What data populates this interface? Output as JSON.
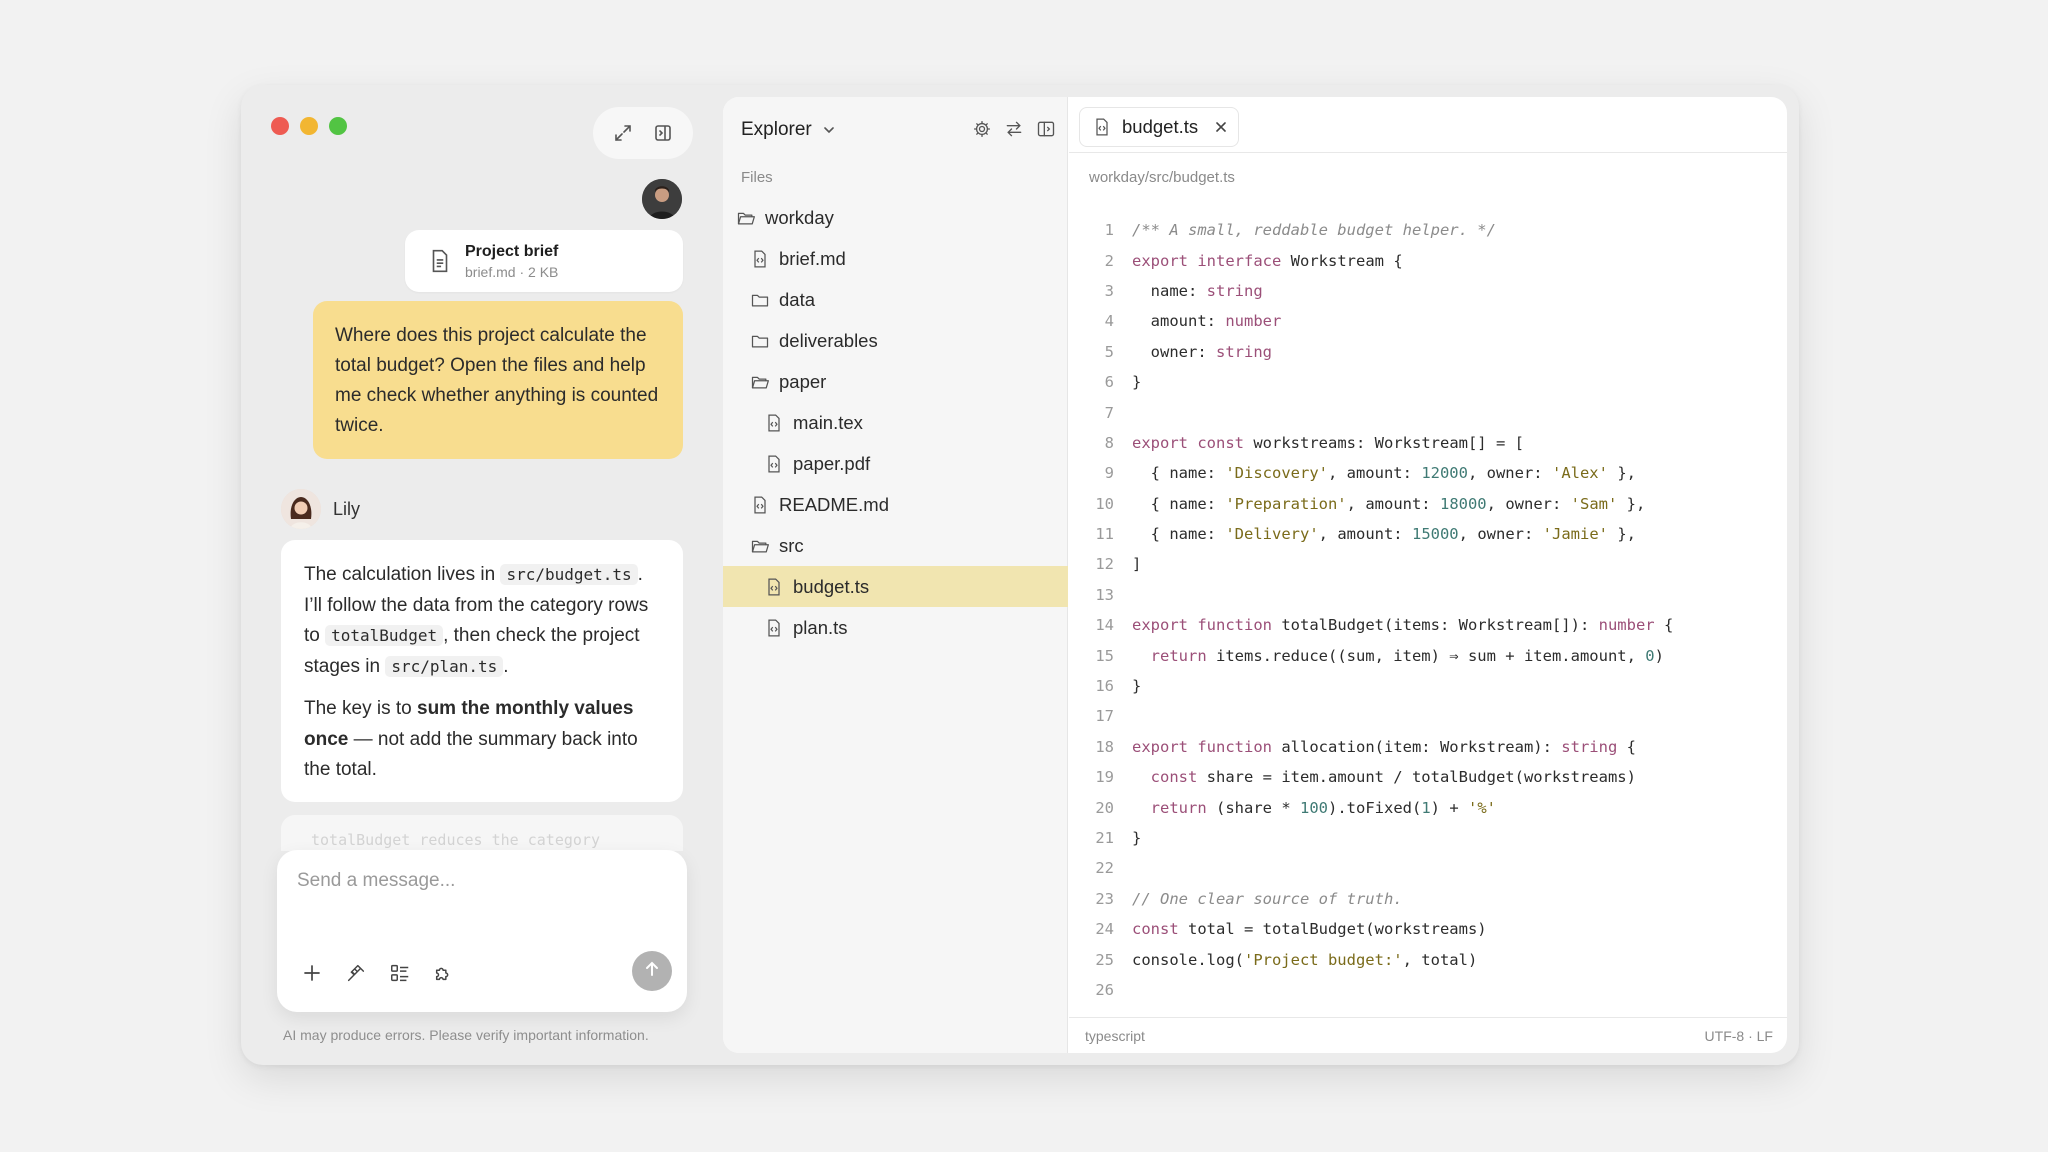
{
  "window": {
    "traffic_lights": [
      "close",
      "minimize",
      "maximize"
    ],
    "top_tools": [
      "expand-icon",
      "panel-toggle-icon"
    ]
  },
  "chat": {
    "attachment": {
      "title": "Project brief",
      "subtitle": "brief.md · 2 KB",
      "icon": "document-icon"
    },
    "user_message": "Where does this project calculate the total budget? Open the files and help me check whether anything is counted twice.",
    "assistant": {
      "name": "Lily",
      "p1": {
        "t1": "The calculation lives in ",
        "c1": "src/budget.ts",
        "t2": ". I’ll follow the data from the category rows to ",
        "c2": "totalBudget",
        "t3": ", then check the project stages in ",
        "c3": "src/plan.ts",
        "t4": "."
      },
      "p2": {
        "t1": "The key is to ",
        "b1": "sum the monthly values once",
        "t2": " — not add the summary back into the total."
      }
    },
    "faded_preview": "totalBudget reduces the category",
    "composer": {
      "placeholder": "Send a message...",
      "tools": [
        "plus-icon",
        "plug-icon",
        "list-icon",
        "puzzle-icon"
      ],
      "send_icon": "arrow-up-icon"
    },
    "disclaimer": "AI may produce errors. Please verify important information."
  },
  "explorer": {
    "title": "Explorer",
    "tools": [
      "gear-icon",
      "swap-icon",
      "split-panel-icon"
    ],
    "section_label": "Files",
    "tree": [
      {
        "label": "workday",
        "kind": "folder-open",
        "depth": 0
      },
      {
        "label": "brief.md",
        "kind": "file",
        "depth": 1
      },
      {
        "label": "data",
        "kind": "folder",
        "depth": 1
      },
      {
        "label": "deliverables",
        "kind": "folder",
        "depth": 1
      },
      {
        "label": "paper",
        "kind": "folder-open",
        "depth": 1
      },
      {
        "label": "main.tex",
        "kind": "file",
        "depth": 2
      },
      {
        "label": "paper.pdf",
        "kind": "file",
        "depth": 2
      },
      {
        "label": "README.md",
        "kind": "file",
        "depth": 1
      },
      {
        "label": "src",
        "kind": "folder-open",
        "depth": 1
      },
      {
        "label": "budget.ts",
        "kind": "file",
        "depth": 2,
        "selected": true
      },
      {
        "label": "plan.ts",
        "kind": "file",
        "depth": 2
      }
    ]
  },
  "editor": {
    "tab": {
      "label": "budget.ts"
    },
    "path": "workday/src/budget.ts",
    "lines": [
      [
        [
          "c",
          "/** A small, reddable budget helper. */"
        ]
      ],
      [
        [
          "k",
          "export"
        ],
        [
          "p",
          " "
        ],
        [
          "k",
          "interface"
        ],
        [
          "p",
          " Workstream {"
        ]
      ],
      [
        [
          "p",
          "  name: "
        ],
        [
          "t",
          "string"
        ]
      ],
      [
        [
          "p",
          "  amount: "
        ],
        [
          "t",
          "number"
        ]
      ],
      [
        [
          "p",
          "  owner: "
        ],
        [
          "t",
          "string"
        ]
      ],
      [
        [
          "p",
          "}"
        ]
      ],
      [],
      [
        [
          "k",
          "export"
        ],
        [
          "p",
          " "
        ],
        [
          "k",
          "const"
        ],
        [
          "p",
          " workstreams: Workstream[] = ["
        ]
      ],
      [
        [
          "p",
          "  { name: "
        ],
        [
          "s",
          "'Discovery'"
        ],
        [
          "p",
          ", amount: "
        ],
        [
          "n",
          "12000"
        ],
        [
          "p",
          ", owner: "
        ],
        [
          "s",
          "'Alex'"
        ],
        [
          "p",
          " },"
        ]
      ],
      [
        [
          "p",
          "  { name: "
        ],
        [
          "s",
          "'Preparation'"
        ],
        [
          "p",
          ", amount: "
        ],
        [
          "n",
          "18000"
        ],
        [
          "p",
          ", owner: "
        ],
        [
          "s",
          "'Sam'"
        ],
        [
          "p",
          " },"
        ]
      ],
      [
        [
          "p",
          "  { name: "
        ],
        [
          "s",
          "'Delivery'"
        ],
        [
          "p",
          ", amount: "
        ],
        [
          "n",
          "15000"
        ],
        [
          "p",
          ", owner: "
        ],
        [
          "s",
          "'Jamie'"
        ],
        [
          "p",
          " },"
        ]
      ],
      [
        [
          "p",
          "]"
        ]
      ],
      [],
      [
        [
          "k",
          "export"
        ],
        [
          "p",
          " "
        ],
        [
          "k",
          "function"
        ],
        [
          "p",
          " totalBudget(items: Workstream[]): "
        ],
        [
          "t",
          "number"
        ],
        [
          "p",
          " {"
        ]
      ],
      [
        [
          "p",
          "  "
        ],
        [
          "k",
          "return"
        ],
        [
          "p",
          " items.reduce((sum, item) ⇒ sum + item.amount, "
        ],
        [
          "n",
          "0"
        ],
        [
          "p",
          ")"
        ]
      ],
      [
        [
          "p",
          "}"
        ]
      ],
      [],
      [
        [
          "k",
          "export"
        ],
        [
          "p",
          " "
        ],
        [
          "k",
          "function"
        ],
        [
          "p",
          " allocation(item: Workstream): "
        ],
        [
          "t",
          "string"
        ],
        [
          "p",
          " {"
        ]
      ],
      [
        [
          "p",
          "  "
        ],
        [
          "k",
          "const"
        ],
        [
          "p",
          " share = item.amount / totalBudget(workstreams)"
        ]
      ],
      [
        [
          "p",
          "  "
        ],
        [
          "k",
          "return"
        ],
        [
          "p",
          " (share * "
        ],
        [
          "n",
          "100"
        ],
        [
          "p",
          ").toFixed("
        ],
        [
          "n",
          "1"
        ],
        [
          "p",
          ") + "
        ],
        [
          "s",
          "'%'"
        ]
      ],
      [
        [
          "p",
          "}"
        ]
      ],
      [],
      [
        [
          "c",
          "// One clear source of truth."
        ]
      ],
      [
        [
          "k",
          "const"
        ],
        [
          "p",
          " total = totalBudget(workstreams)"
        ]
      ],
      [
        [
          "p",
          "console.log("
        ],
        [
          "s",
          "'Project budget:'"
        ],
        [
          "p",
          ", total)"
        ]
      ],
      []
    ],
    "status_left": "typescript",
    "status_right": "UTF-8 · LF"
  }
}
